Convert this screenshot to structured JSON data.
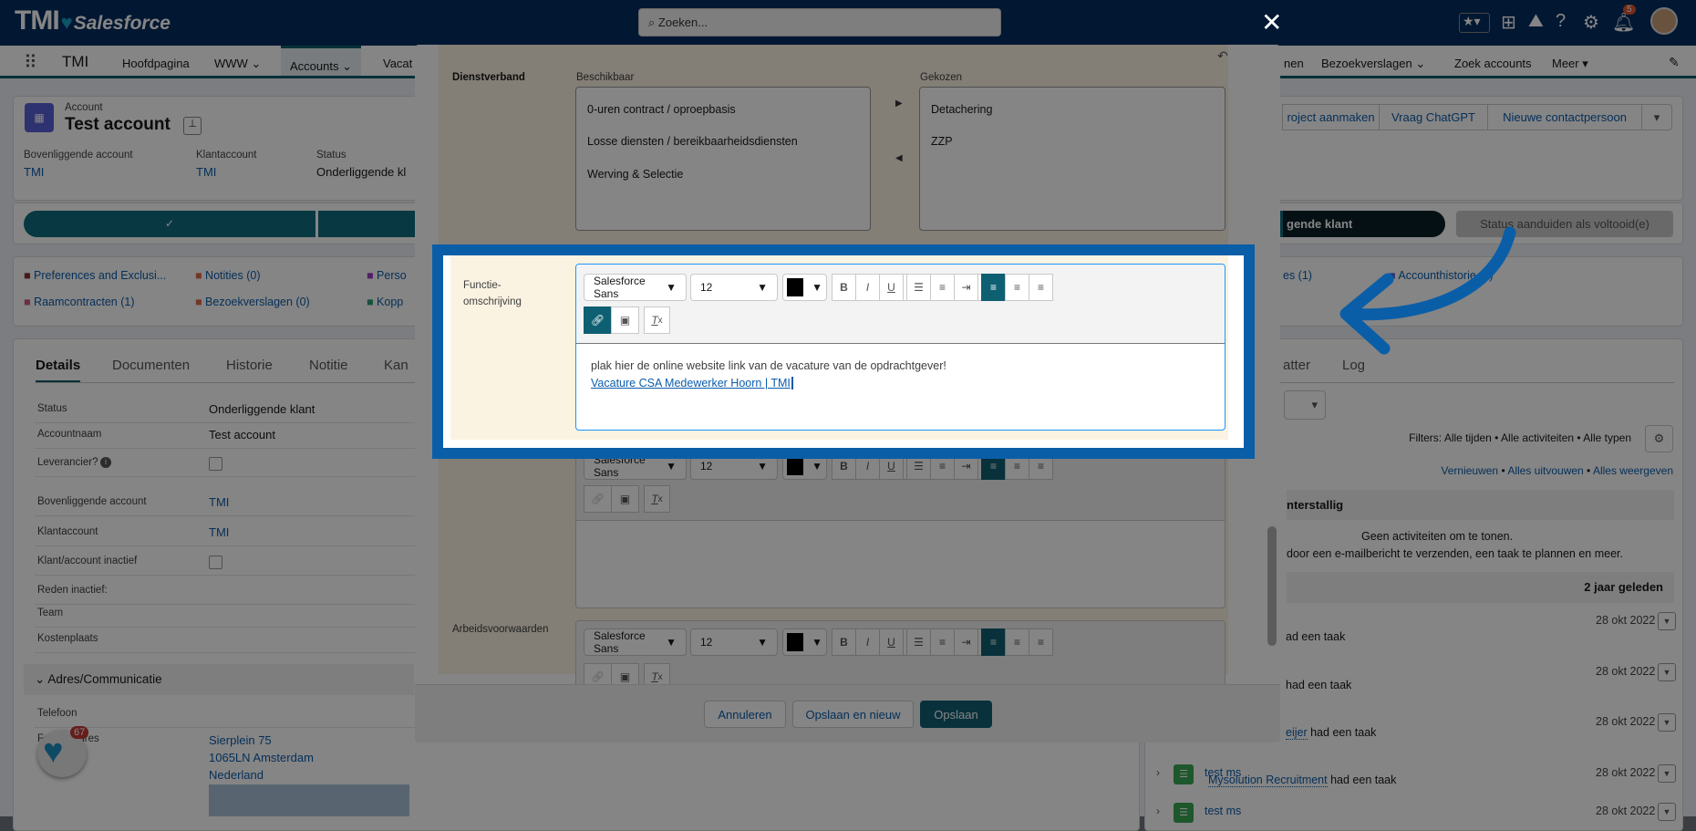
{
  "header": {
    "logo_text": "TMI",
    "logo_sub": "Salesforce",
    "search_placeholder": "Zoeken...",
    "notification_count": "5",
    "close_glyph": "✕"
  },
  "nav": {
    "app_name": "TMI",
    "items": [
      "Hoofdpagina",
      "WWW",
      "Accounts",
      "Vacat",
      "nen",
      "Bezoekverslagen",
      "Zoek accounts",
      "Meer"
    ]
  },
  "account": {
    "type_label": "Account",
    "name": "Test account",
    "fields": [
      {
        "label": "Bovenliggende account",
        "value": "TMI"
      },
      {
        "label": "Klantaccount",
        "value": "TMI"
      },
      {
        "label": "Status",
        "value": "Onderliggende kl"
      }
    ],
    "actions": [
      "roject aanmaken",
      "Vraag ChatGPT",
      "Nieuwe contactpersoon"
    ]
  },
  "path": {
    "current_stage": "gende klant",
    "complete_button": "Status aanduiden als voltooid(e)"
  },
  "related": [
    "Preferences and Exclusi...",
    "Notities (0)",
    "Perso",
    "Raamcontracten (1)",
    "Bezoekverslagen (0)",
    "Kopp",
    "es (1)",
    "Accounthistorie (3)"
  ],
  "tabs": {
    "left": [
      "Details",
      "Documenten",
      "Historie",
      "Notitie",
      "Kan"
    ],
    "right": [
      "atter",
      "Log"
    ]
  },
  "details": [
    {
      "label": "Status",
      "value": "Onderliggende klant"
    },
    {
      "label": "Accountnaam",
      "value": "Test account"
    },
    {
      "label": "Leverancier?",
      "value": ""
    },
    {
      "label": "Bovenliggende account",
      "value": "TMI"
    },
    {
      "label": "Klantaccount",
      "value": "TMI"
    },
    {
      "label": "Klant/account inactief",
      "value": ""
    },
    {
      "label": "Reden inactief:",
      "value": ""
    },
    {
      "label": "Team",
      "value": ""
    },
    {
      "label": "Kostenplaats",
      "value": ""
    }
  ],
  "address_section": {
    "title": "Adres/Communicatie",
    "phone_label": "Telefoon",
    "address_label": "Factuuradres",
    "address_lines": [
      "Sierplein 75",
      "1065LN Amsterdam",
      "Nederland"
    ]
  },
  "floating_badge": "67",
  "activity": {
    "filters": "Filters: Alle tijden • Alle activiteiten • Alle typen",
    "links": [
      "Vernieuwen",
      "Alles uitvouwen",
      "Alles weergeven"
    ],
    "overdue_header": "nterstallig",
    "empty_1": "Geen activiteiten om te tonen.",
    "empty_2": "door een e-mailbericht te verzenden, een taak te plannen en meer.",
    "past_header": "2 jaar geleden",
    "items": [
      {
        "title": "",
        "who": "",
        "text": "ad een taak",
        "date": "28 okt 2022"
      },
      {
        "title": "",
        "who": "",
        "text": "had een taak",
        "date": "28 okt 2022"
      },
      {
        "title": "",
        "who": "eijer",
        "text": "had een taak",
        "date": "28 okt 2022"
      },
      {
        "title": "test ms",
        "who": "Mysolution Recruitment",
        "text": "had een taak",
        "date": "28 okt 2022"
      },
      {
        "title": "test ms",
        "who": "",
        "text": "",
        "date": "28 okt 2022"
      }
    ]
  },
  "modal": {
    "dienstverband": {
      "label": "Dienstverband",
      "available_label": "Beschikbaar",
      "available": [
        "0-uren contract / oproepbasis",
        "Losse diensten / bereikbaarheidsdiensten",
        "Werving & Selectie"
      ],
      "chosen_label": "Gekozen",
      "chosen": [
        "Detachering",
        "ZZP"
      ]
    },
    "functie": {
      "label": "Functie-omschrijving",
      "text": "plak hier de online website link van de vacature van de opdrachtgever!",
      "link": "Vacature CSA Medewerker Hoorn | TMI"
    },
    "arbeids_label": "Arbeidsvoorwaarden",
    "toolbar": {
      "font": "Salesforce Sans",
      "size": "12",
      "text_color": "#000000"
    },
    "footer": {
      "cancel": "Annuleren",
      "save_new": "Opslaan en nieuw",
      "save": "Opslaan"
    }
  },
  "colors": {
    "brand": "#032d60",
    "accent": "#0f5f73",
    "highlight": "#0a5ea8",
    "link": "#0b5cab"
  }
}
